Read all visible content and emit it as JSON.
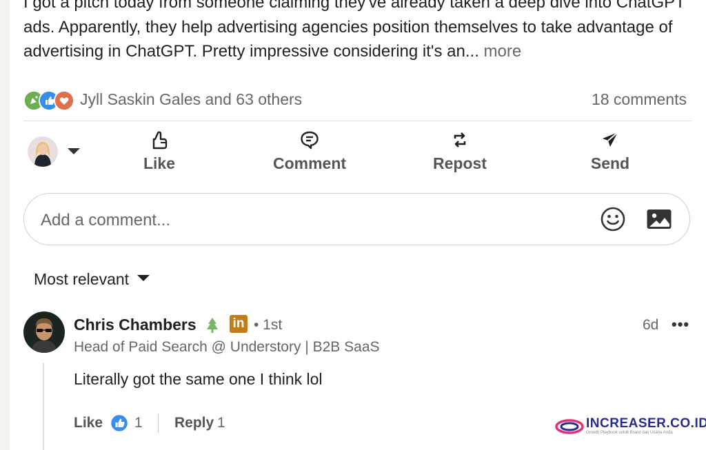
{
  "post": {
    "text": "I got a pitch today from someone claiming they've already taken a deep dive into ChatGPT ads. Apparently, they help advertising agencies position themselves to take advantage of advertising in ChatGPT. Pretty impressive considering it's an...",
    "more_label": "more"
  },
  "social": {
    "reaction_icons": [
      "celebrate-icon",
      "like-icon",
      "love-icon"
    ],
    "reactors": "Jyll Saskin Gales and 63 others",
    "comments": "18 comments"
  },
  "actions": [
    {
      "label": "Like",
      "icon": "thumbs-up-icon"
    },
    {
      "label": "Comment",
      "icon": "speech-bubble-icon"
    },
    {
      "label": "Repost",
      "icon": "repost-icon"
    },
    {
      "label": "Send",
      "icon": "paper-plane-icon"
    }
  ],
  "composer": {
    "placeholder": "Add a comment...",
    "emoji_icon": "smiley-icon",
    "image_icon": "image-icon"
  },
  "sort": {
    "label": "Most relevant"
  },
  "comment": {
    "author": "Chris Chambers",
    "badge_icon": "tree-icon",
    "linkedin_badge": "in",
    "degree": "• 1st",
    "time": "6d",
    "more": "•••",
    "headline": "Head of Paid Search @ Understory | B2B SaaS",
    "body": "Literally got the same one I think lol",
    "like_label": "Like",
    "like_count": "1",
    "reply_label": "Reply",
    "reply_count": "1"
  },
  "watermark": {
    "brand": "INCREASER.CO.ID",
    "tagline": "Growth Playbook untuk Brand dan Usaha Anda"
  },
  "colors": {
    "like_blue": "#378fe9",
    "love_red": "#df704d",
    "celebrate_green": "#44712e",
    "linkedin_gold": "#c37d16",
    "brand_navy": "#2a2b8f"
  }
}
